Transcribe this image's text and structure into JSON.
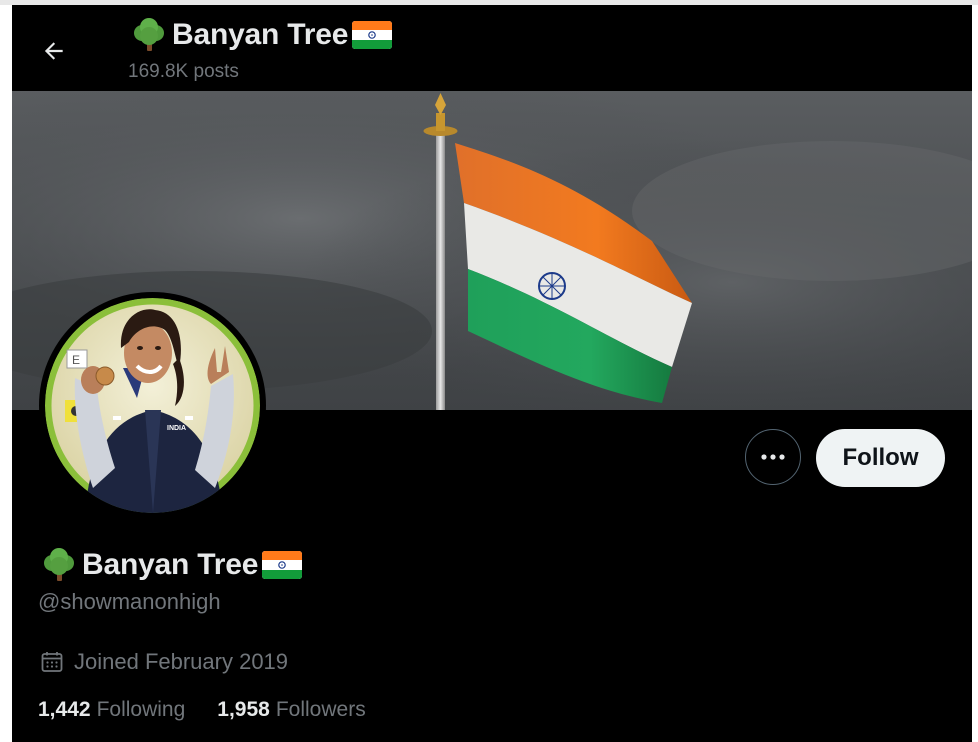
{
  "header": {
    "name": "Banyan Tree",
    "posts": "169.8K posts"
  },
  "profile": {
    "name": "Banyan Tree",
    "handle": "@showmanonhigh",
    "joined": "Joined February 2019",
    "following_count": "1,442",
    "following_label": "Following",
    "followers_count": "1,958",
    "followers_label": "Followers"
  },
  "actions": {
    "follow_label": "Follow",
    "more_icon": "ellipsis-icon"
  },
  "icons": {
    "back": "back-arrow-icon",
    "tree": "tree-emoji-icon",
    "flag": "india-flag-icon",
    "calendar": "calendar-icon"
  },
  "colors": {
    "background": "#000000",
    "primary_text": "#e7e9ea",
    "secondary_text": "#71767b",
    "follow_button_bg": "#eff3f4",
    "flag_saffron": "#ff7a1a",
    "flag_green": "#129c3a",
    "chakra_blue": "#1c3a8a"
  }
}
